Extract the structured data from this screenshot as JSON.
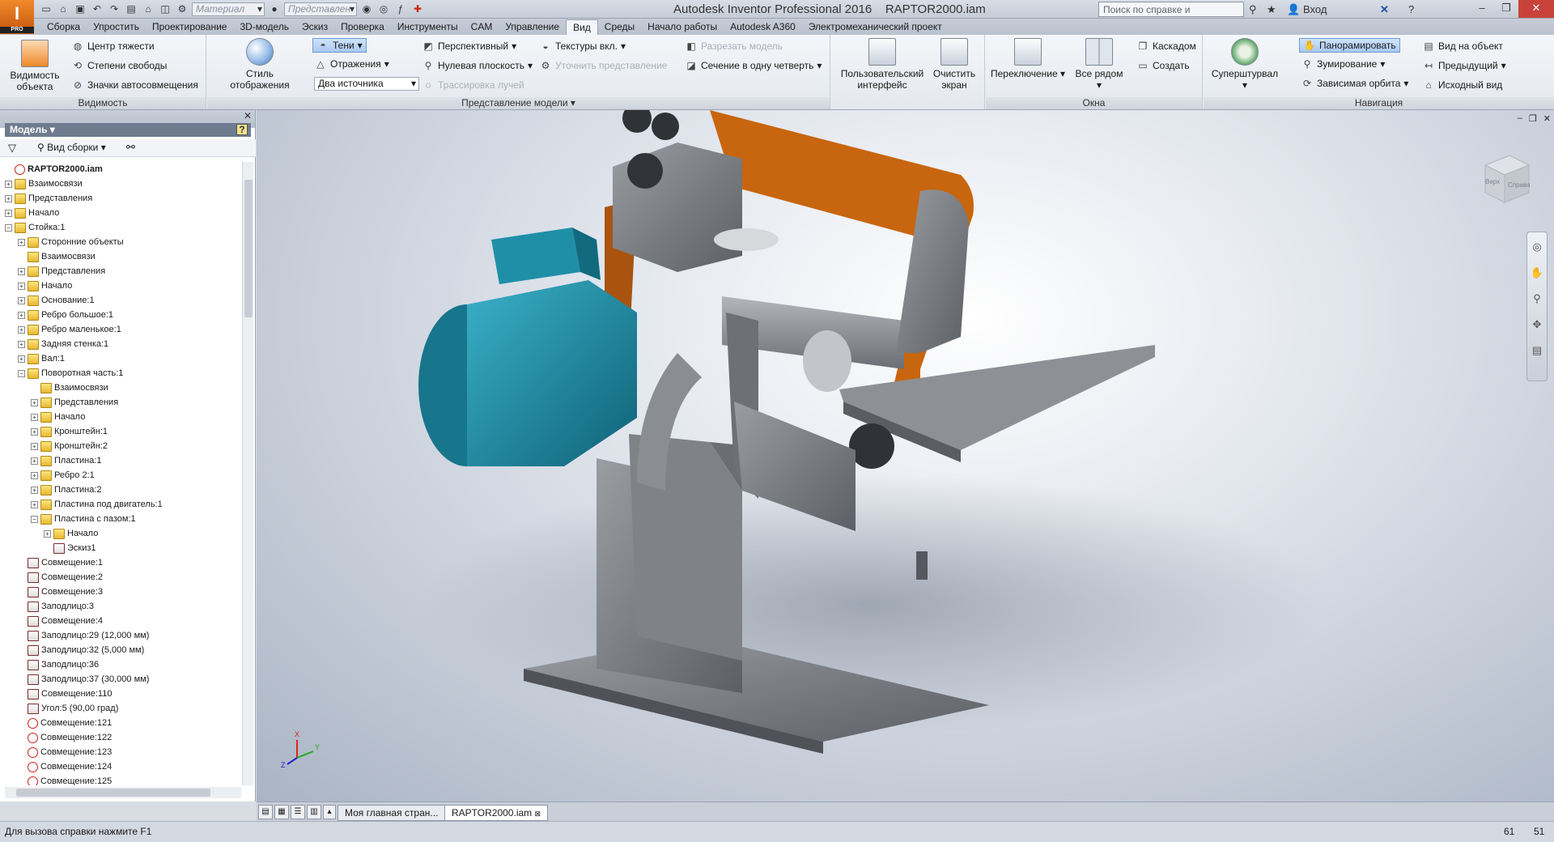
{
  "app": {
    "logo_text": "I",
    "logo_sub": "PRO",
    "title": "Autodesk Inventor Professional 2016    RAPTOR2000.iam",
    "qat_material": "Материал",
    "qat_representation": "Представлен",
    "help_search_placeholder": "Поиск по справке и командам...",
    "signin_label": "Вход"
  },
  "ribbon_tabs": [
    "Сборка",
    "Упростить",
    "Проектирование",
    "3D-модель",
    "Эскиз",
    "Проверка",
    "Инструменты",
    "CAM",
    "Управление",
    "Вид",
    "Среды",
    "Начало работы",
    "Autodesk A360",
    "Электромеханический проект"
  ],
  "active_tab": "Вид",
  "panels": {
    "visibility": {
      "title": "Видимость",
      "big": "Видимость объекта",
      "items": [
        "Центр тяжести",
        "Степени свободы",
        "Значки автосовмещения"
      ]
    },
    "model_view": {
      "title": "Представление модели",
      "big": "Стиль отображения",
      "shadows": "Тени",
      "reflections": "Отражения",
      "light_source": "Два источника",
      "perspective": "Перспективный",
      "ground_plane": "Нулевая плоскость",
      "ray_tracing": "Трассировка лучей",
      "textures": "Текстуры вкл.",
      "refine": "Уточнить представление",
      "split_model": "Разрезать модель",
      "quarter_section": "Сечение в одну четверть"
    },
    "ui": {
      "user_interface": "Пользовательский интерфейс",
      "clean_screen": "Очистить экран"
    },
    "windows": {
      "title": "Окна",
      "switch": "Переключение",
      "tile": "Все рядом",
      "cascade": "Каскадом",
      "new": "Создать"
    },
    "navigation": {
      "title": "Навигация",
      "steering": "Суперштурвал",
      "pan": "Панорамировать",
      "zoom": "Зумирование",
      "orbit": "Зависимая орбита",
      "look_at": "Вид на объект",
      "previous": "Предыдущий",
      "home": "Исходный вид"
    }
  },
  "browser": {
    "title": "Модель",
    "view_label": "Вид сборки",
    "help": "?",
    "tree": [
      {
        "label": "RAPTOR2000.iam",
        "level": 0,
        "pm": "",
        "type": "q",
        "root": true
      },
      {
        "label": "Взаимосвязи",
        "level": 0,
        "pm": "+",
        "type": "f"
      },
      {
        "label": "Представления",
        "level": 0,
        "pm": "+",
        "type": "f"
      },
      {
        "label": "Начало",
        "level": 0,
        "pm": "+",
        "type": "f"
      },
      {
        "label": "Стойка:1",
        "level": 0,
        "pm": "−",
        "type": "f"
      },
      {
        "label": "Сторонние объекты",
        "level": 1,
        "pm": "+",
        "type": "f"
      },
      {
        "label": "Взаимосвязи",
        "level": 1,
        "pm": "",
        "type": "f"
      },
      {
        "label": "Представления",
        "level": 1,
        "pm": "+",
        "type": "f"
      },
      {
        "label": "Начало",
        "level": 1,
        "pm": "+",
        "type": "f"
      },
      {
        "label": "Основание:1",
        "level": 1,
        "pm": "+",
        "type": "f"
      },
      {
        "label": "Ребро большое:1",
        "level": 1,
        "pm": "+",
        "type": "f"
      },
      {
        "label": "Ребро маленькое:1",
        "level": 1,
        "pm": "+",
        "type": "f"
      },
      {
        "label": "Задняя стенка:1",
        "level": 1,
        "pm": "+",
        "type": "f"
      },
      {
        "label": "Вал:1",
        "level": 1,
        "pm": "+",
        "type": "f"
      },
      {
        "label": "Поворотная часть:1",
        "level": 1,
        "pm": "−",
        "type": "f"
      },
      {
        "label": "Взаимосвязи",
        "level": 2,
        "pm": "",
        "type": "f"
      },
      {
        "label": "Представления",
        "level": 2,
        "pm": "+",
        "type": "f"
      },
      {
        "label": "Начало",
        "level": 2,
        "pm": "+",
        "type": "f"
      },
      {
        "label": "Кронштейн:1",
        "level": 2,
        "pm": "+",
        "type": "f"
      },
      {
        "label": "Кронштейн:2",
        "level": 2,
        "pm": "+",
        "type": "f"
      },
      {
        "label": "Пластина:1",
        "level": 2,
        "pm": "+",
        "type": "f"
      },
      {
        "label": "Ребро 2:1",
        "level": 2,
        "pm": "+",
        "type": "f"
      },
      {
        "label": "Пластина:2",
        "level": 2,
        "pm": "+",
        "type": "f"
      },
      {
        "label": "Пластина под двигатель:1",
        "level": 2,
        "pm": "+",
        "type": "f"
      },
      {
        "label": "Пластина с пазом:1",
        "level": 2,
        "pm": "−",
        "type": "f"
      },
      {
        "label": "Начало",
        "level": 3,
        "pm": "+",
        "type": "f"
      },
      {
        "label": "Эскиз1",
        "level": 3,
        "pm": "",
        "type": "c"
      },
      {
        "label": "Совмещение:1",
        "level": 1,
        "pm": "",
        "type": "c"
      },
      {
        "label": "Совмещение:2",
        "level": 1,
        "pm": "",
        "type": "c"
      },
      {
        "label": "Совмещение:3",
        "level": 1,
        "pm": "",
        "type": "c"
      },
      {
        "label": "Заподлицо:3",
        "level": 1,
        "pm": "",
        "type": "c"
      },
      {
        "label": "Совмещение:4",
        "level": 1,
        "pm": "",
        "type": "c"
      },
      {
        "label": "Заподлицо:29 (12,000 мм)",
        "level": 1,
        "pm": "",
        "type": "c"
      },
      {
        "label": "Заподлицо:32 (5,000 мм)",
        "level": 1,
        "pm": "",
        "type": "c"
      },
      {
        "label": "Заподлицо:36",
        "level": 1,
        "pm": "",
        "type": "c"
      },
      {
        "label": "Заподлицо:37 (30,000 мм)",
        "level": 1,
        "pm": "",
        "type": "c"
      },
      {
        "label": "Совмещение:110",
        "level": 1,
        "pm": "",
        "type": "c"
      },
      {
        "label": "Угол:5 (90,00 град)",
        "level": 1,
        "pm": "",
        "type": "c"
      },
      {
        "label": "Совмещение:121",
        "level": 1,
        "pm": "",
        "type": "q"
      },
      {
        "label": "Совмещение:122",
        "level": 1,
        "pm": "",
        "type": "q"
      },
      {
        "label": "Совмещение:123",
        "level": 1,
        "pm": "",
        "type": "q"
      },
      {
        "label": "Совмещение:124",
        "level": 1,
        "pm": "",
        "type": "q"
      },
      {
        "label": "Совмещение:125",
        "level": 1,
        "pm": "",
        "type": "q"
      }
    ]
  },
  "viewcube": {
    "face1": "Верх",
    "face2": "Справа"
  },
  "triad": {
    "x": "X",
    "y": "Y",
    "z": "Z"
  },
  "doc_tabs": [
    "Моя главная стран...",
    "RAPTOR2000.iam"
  ],
  "status": {
    "hint": "Для вызова справки нажмите F1",
    "n1": "61",
    "n2": "51"
  },
  "colors": {
    "accent": "#f08a2a",
    "motor": "#1f8fa8",
    "belt": "#c8650f",
    "metal": "#7a7d82"
  }
}
